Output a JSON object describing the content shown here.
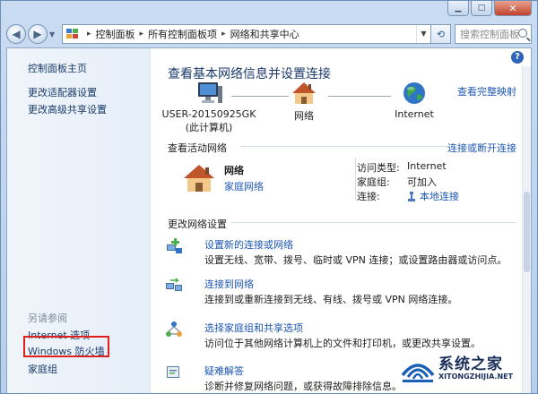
{
  "address": {
    "crumbs": [
      "控制面板",
      "所有控制面板项",
      "网络和共享中心"
    ],
    "search_placeholder": "搜索控制面板"
  },
  "sidebar": {
    "home": "控制面板主页",
    "items": [
      "更改适配器设置",
      "更改高级共享设置"
    ],
    "see_also_label": "另请参阅",
    "see_also": [
      "Internet 选项",
      "Windows 防火墙",
      "家庭组"
    ]
  },
  "main": {
    "title": "查看基本网络信息并设置连接",
    "full_map_link": "查看完整映射",
    "map": {
      "computer_name": "USER-20150925GK",
      "computer_sub": "(此计算机)",
      "network": "网络",
      "internet": "Internet"
    },
    "active": {
      "label": "查看活动网络",
      "connect_link": "连接或断开连接",
      "network_name": "网络",
      "network_type": "家庭网络",
      "props": [
        {
          "label": "访问类型:",
          "value": "Internet"
        },
        {
          "label": "家庭组:",
          "value": "可加入"
        },
        {
          "label": "连接:",
          "value": "本地连接"
        }
      ]
    },
    "change": {
      "label": "更改网络设置",
      "tasks": [
        {
          "title": "设置新的连接或网络",
          "desc": "设置无线、宽带、拨号、临时或 VPN 连接；或设置路由器或访问点。"
        },
        {
          "title": "连接到网络",
          "desc": "连接到或重新连接到无线、有线、拨号或 VPN 网络连接。"
        },
        {
          "title": "选择家庭组和共享选项",
          "desc": "访问位于其他网络计算机上的文件和打印机，或更改共享设置。"
        },
        {
          "title": "疑难解答",
          "desc": "诊断并修复网络问题，或获得故障排除信息。"
        }
      ]
    }
  },
  "watermark": {
    "title": "系统之家",
    "url": "XITONGZHIJIA.NET"
  }
}
